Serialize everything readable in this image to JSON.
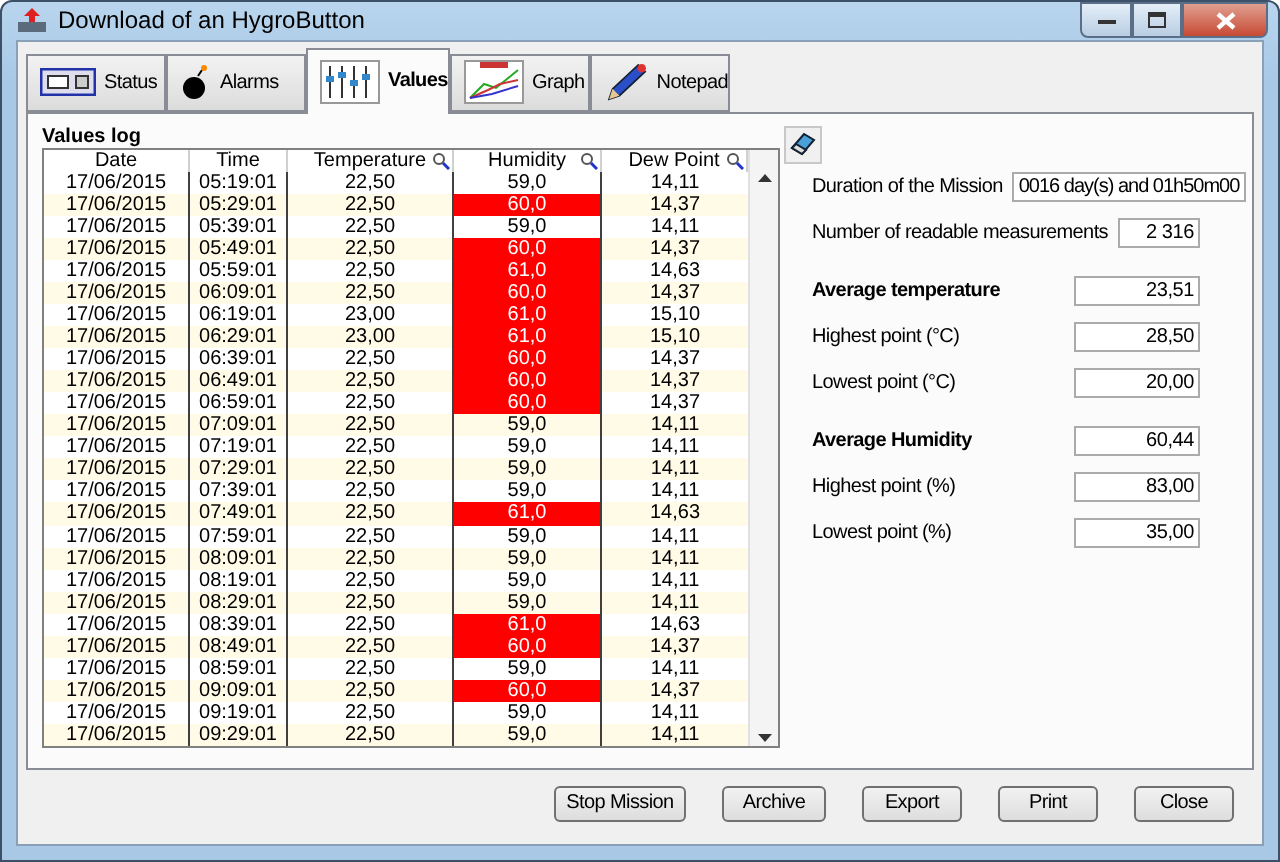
{
  "window": {
    "title": "Download of an HygroButton"
  },
  "tabs": [
    {
      "label": "Status",
      "selected": false
    },
    {
      "label": "Alarms",
      "selected": false
    },
    {
      "label": "Values",
      "selected": true
    },
    {
      "label": "Graph",
      "selected": false
    },
    {
      "label": "Notepad",
      "selected": false
    }
  ],
  "values_log": {
    "title": "Values log",
    "columns": [
      {
        "label": "Date",
        "searchable": false
      },
      {
        "label": "Time",
        "searchable": false
      },
      {
        "label": "Temperature",
        "searchable": true
      },
      {
        "label": "Humidity",
        "searchable": true
      },
      {
        "label": "Dew Point",
        "searchable": true
      }
    ],
    "rows": [
      {
        "date": "17/06/2015",
        "time": "05:19:01",
        "temperature": "22,50",
        "humidity": "59,0",
        "dew_point": "14,11",
        "alarm": false
      },
      {
        "date": "17/06/2015",
        "time": "05:29:01",
        "temperature": "22,50",
        "humidity": "60,0",
        "dew_point": "14,37",
        "alarm": true
      },
      {
        "date": "17/06/2015",
        "time": "05:39:01",
        "temperature": "22,50",
        "humidity": "59,0",
        "dew_point": "14,11",
        "alarm": false
      },
      {
        "date": "17/06/2015",
        "time": "05:49:01",
        "temperature": "22,50",
        "humidity": "60,0",
        "dew_point": "14,37",
        "alarm": true
      },
      {
        "date": "17/06/2015",
        "time": "05:59:01",
        "temperature": "22,50",
        "humidity": "61,0",
        "dew_point": "14,63",
        "alarm": true
      },
      {
        "date": "17/06/2015",
        "time": "06:09:01",
        "temperature": "22,50",
        "humidity": "60,0",
        "dew_point": "14,37",
        "alarm": true
      },
      {
        "date": "17/06/2015",
        "time": "06:19:01",
        "temperature": "23,00",
        "humidity": "61,0",
        "dew_point": "15,10",
        "alarm": true
      },
      {
        "date": "17/06/2015",
        "time": "06:29:01",
        "temperature": "23,00",
        "humidity": "61,0",
        "dew_point": "15,10",
        "alarm": true
      },
      {
        "date": "17/06/2015",
        "time": "06:39:01",
        "temperature": "22,50",
        "humidity": "60,0",
        "dew_point": "14,37",
        "alarm": true
      },
      {
        "date": "17/06/2015",
        "time": "06:49:01",
        "temperature": "22,50",
        "humidity": "60,0",
        "dew_point": "14,37",
        "alarm": true
      },
      {
        "date": "17/06/2015",
        "time": "06:59:01",
        "temperature": "22,50",
        "humidity": "60,0",
        "dew_point": "14,37",
        "alarm": true
      },
      {
        "date": "17/06/2015",
        "time": "07:09:01",
        "temperature": "22,50",
        "humidity": "59,0",
        "dew_point": "14,11",
        "alarm": false
      },
      {
        "date": "17/06/2015",
        "time": "07:19:01",
        "temperature": "22,50",
        "humidity": "59,0",
        "dew_point": "14,11",
        "alarm": false
      },
      {
        "date": "17/06/2015",
        "time": "07:29:01",
        "temperature": "22,50",
        "humidity": "59,0",
        "dew_point": "14,11",
        "alarm": false
      },
      {
        "date": "17/06/2015",
        "time": "07:39:01",
        "temperature": "22,50",
        "humidity": "59,0",
        "dew_point": "14,11",
        "alarm": false
      },
      {
        "date": "17/06/2015",
        "time": "07:49:01",
        "temperature": "22,50",
        "humidity": "61,0",
        "dew_point": "14,63",
        "alarm": true
      },
      {
        "date": "17/06/2015",
        "time": "07:59:01",
        "temperature": "22,50",
        "humidity": "59,0",
        "dew_point": "14,11",
        "alarm": false
      },
      {
        "date": "17/06/2015",
        "time": "08:09:01",
        "temperature": "22,50",
        "humidity": "59,0",
        "dew_point": "14,11",
        "alarm": false
      },
      {
        "date": "17/06/2015",
        "time": "08:19:01",
        "temperature": "22,50",
        "humidity": "59,0",
        "dew_point": "14,11",
        "alarm": false
      },
      {
        "date": "17/06/2015",
        "time": "08:29:01",
        "temperature": "22,50",
        "humidity": "59,0",
        "dew_point": "14,11",
        "alarm": false
      },
      {
        "date": "17/06/2015",
        "time": "08:39:01",
        "temperature": "22,50",
        "humidity": "61,0",
        "dew_point": "14,63",
        "alarm": true
      },
      {
        "date": "17/06/2015",
        "time": "08:49:01",
        "temperature": "22,50",
        "humidity": "60,0",
        "dew_point": "14,37",
        "alarm": true
      },
      {
        "date": "17/06/2015",
        "time": "08:59:01",
        "temperature": "22,50",
        "humidity": "59,0",
        "dew_point": "14,11",
        "alarm": false
      },
      {
        "date": "17/06/2015",
        "time": "09:09:01",
        "temperature": "22,50",
        "humidity": "60,0",
        "dew_point": "14,37",
        "alarm": true
      },
      {
        "date": "17/06/2015",
        "time": "09:19:01",
        "temperature": "22,50",
        "humidity": "59,0",
        "dew_point": "14,11",
        "alarm": false
      },
      {
        "date": "17/06/2015",
        "time": "09:29:01",
        "temperature": "22,50",
        "humidity": "59,0",
        "dew_point": "14,11",
        "alarm": false
      }
    ]
  },
  "summary": [
    {
      "kind": "inline",
      "label": "Duration of the Mission",
      "value": "0016 day(s) and 01h50m00",
      "bold": false
    },
    {
      "kind": "stat",
      "label": "Number of readable measurements",
      "value": "2 316",
      "bold": false
    },
    {
      "kind": "stat",
      "label": "Average temperature",
      "value": "23,51",
      "bold": true
    },
    {
      "kind": "stat",
      "label": "Highest point (°C)",
      "value": "28,50",
      "bold": false
    },
    {
      "kind": "stat",
      "label": "Lowest point (°C)",
      "value": "20,00",
      "bold": false
    },
    {
      "kind": "stat",
      "label": "Average Humidity",
      "value": "60,44",
      "bold": true
    },
    {
      "kind": "stat",
      "label": "Highest point (%)",
      "value": "83,00",
      "bold": false
    },
    {
      "kind": "stat",
      "label": "Lowest point (%)",
      "value": "35,00",
      "bold": false
    }
  ],
  "buttons": [
    "Stop Mission",
    "Archive",
    "Export",
    "Print",
    "Close"
  ]
}
